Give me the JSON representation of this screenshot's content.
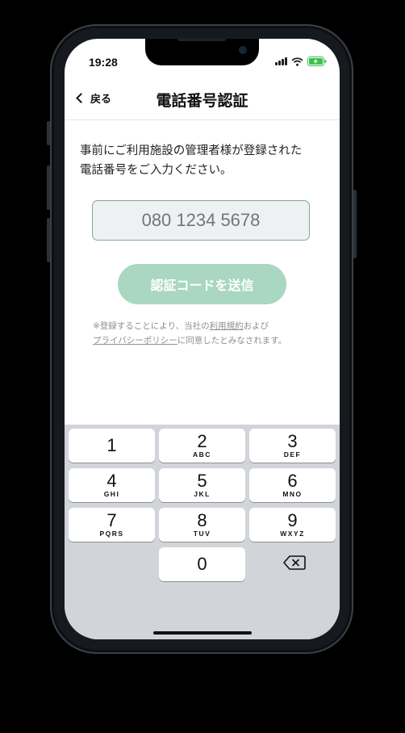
{
  "status_bar": {
    "time": "19:28"
  },
  "nav": {
    "back_label": "戻る",
    "title": "電話番号認証"
  },
  "description": [
    "事前にご利用施設の管理者様が登録された",
    "電話番号をご入力ください。"
  ],
  "phone_input": {
    "placeholder": "080 1234 5678",
    "value": ""
  },
  "send_button": {
    "label": "認証コードを送信"
  },
  "notice": {
    "prefix": "※登録することにより、当社の",
    "terms_link": "利用規約",
    "mid": "および",
    "privacy_link": "プライバシーポリシー",
    "suffix": "に同意したとみなされます。"
  },
  "keypad": {
    "keys": [
      {
        "num": "1",
        "letters": ""
      },
      {
        "num": "2",
        "letters": "ABC"
      },
      {
        "num": "3",
        "letters": "DEF"
      },
      {
        "num": "4",
        "letters": "GHI"
      },
      {
        "num": "5",
        "letters": "JKL"
      },
      {
        "num": "6",
        "letters": "MNO"
      },
      {
        "num": "7",
        "letters": "PQRS"
      },
      {
        "num": "8",
        "letters": "TUV"
      },
      {
        "num": "9",
        "letters": "WXYZ"
      },
      {
        "num": "0",
        "letters": ""
      }
    ],
    "delete_icon": "backspace-icon"
  },
  "colors": {
    "accent_disabled": "#a9d7c1",
    "input_border": "#7faa92",
    "battery": "#3fbf4f",
    "keyboard_bg": "#d1d4d9"
  }
}
